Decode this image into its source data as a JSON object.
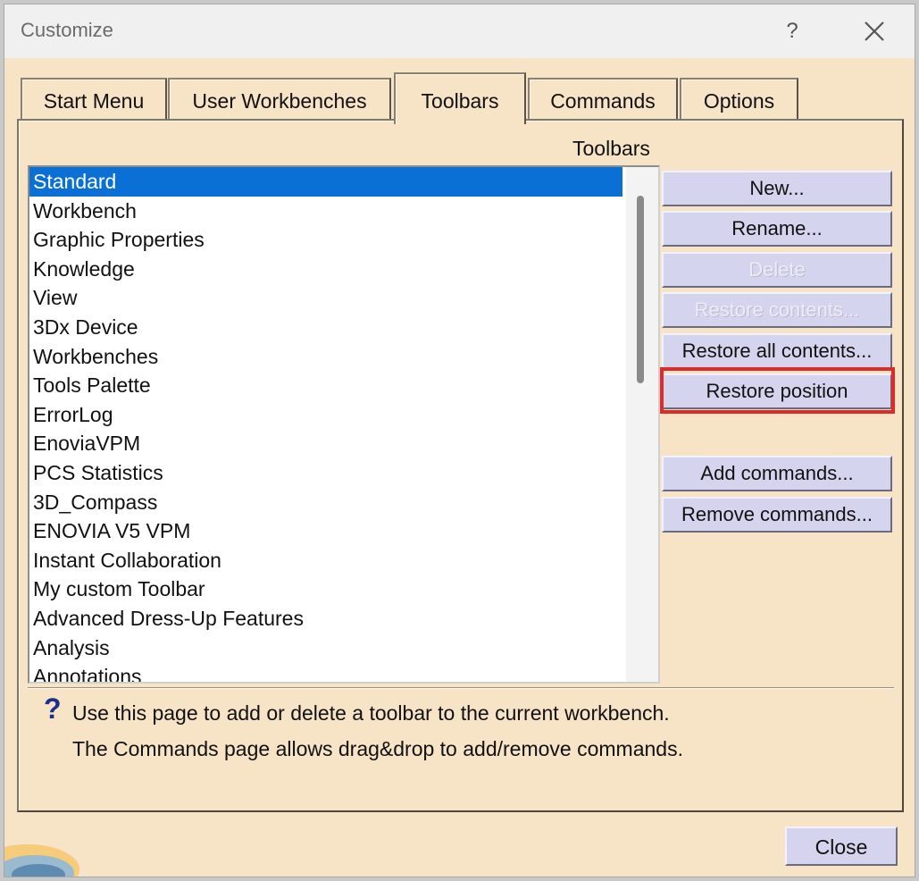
{
  "window": {
    "title": "Customize",
    "help_glyph": "?"
  },
  "tabs": [
    {
      "label": "Start Menu",
      "active": false
    },
    {
      "label": "User Workbenches",
      "active": false
    },
    {
      "label": "Toolbars",
      "active": true
    },
    {
      "label": "Commands",
      "active": false
    },
    {
      "label": "Options",
      "active": false
    }
  ],
  "toolbars_panel": {
    "group_label": "Toolbars",
    "list": {
      "items": [
        "Standard",
        "Workbench",
        "Graphic Properties",
        "Knowledge",
        "View",
        "3Dx Device",
        "Workbenches",
        "Tools Palette",
        "ErrorLog",
        "EnoviaVPM",
        "PCS Statistics",
        "3D_Compass",
        "ENOVIA V5 VPM",
        "Instant Collaboration",
        "My custom Toolbar",
        "Advanced Dress-Up Features",
        "Analysis",
        "Annotations"
      ],
      "selected": "Standard"
    },
    "buttons": {
      "new": "New...",
      "rename": "Rename...",
      "delete": "Delete",
      "restore_contents": "Restore contents...",
      "restore_all_contents": "Restore all contents...",
      "restore_position": "Restore position",
      "add_commands": "Add commands...",
      "remove_commands": "Remove commands..."
    },
    "help": {
      "icon": "?",
      "line1": "Use this page to add or delete a toolbar to the current workbench.",
      "line2": "The Commands page allows drag&drop to add/remove commands."
    }
  },
  "footer": {
    "close_label": "Close"
  },
  "colors": {
    "dialog_background": "#f7e3c6",
    "selection": "#0a70d6",
    "button_face": "#d4d4ee",
    "highlight_annotation": "#e02a2a",
    "help_icon": "#1c2f8c"
  }
}
